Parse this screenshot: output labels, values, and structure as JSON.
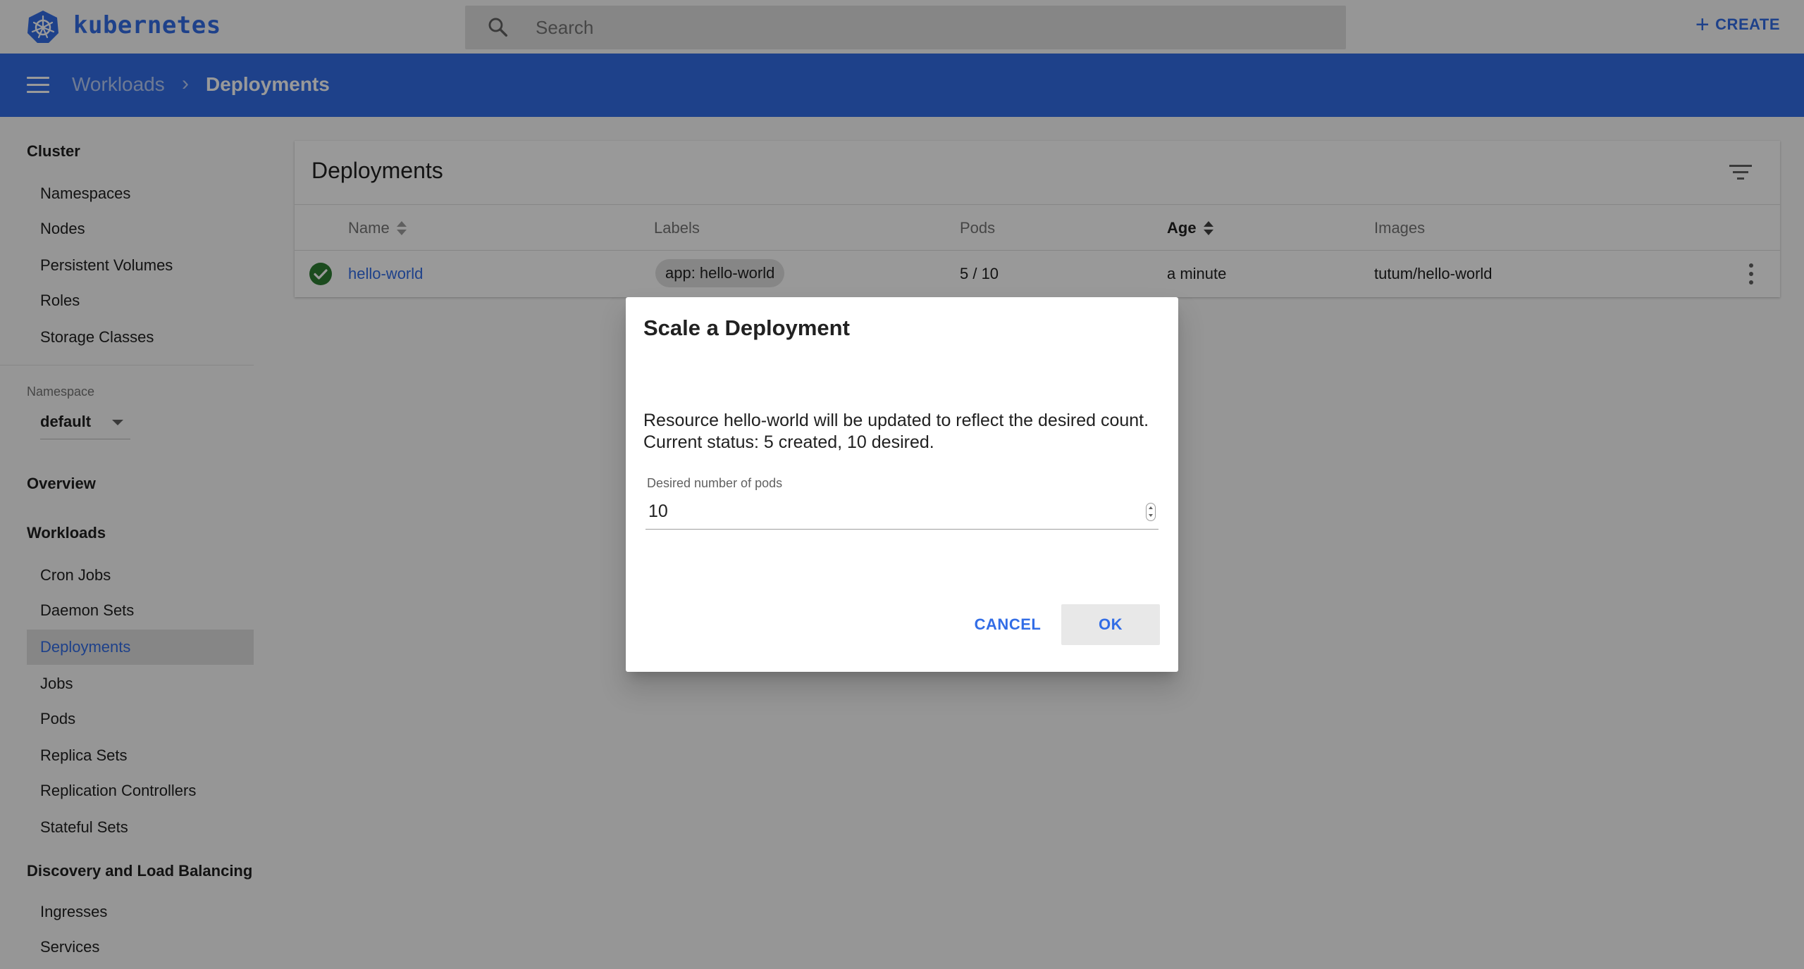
{
  "topbar": {
    "brand": "kubernetes",
    "search_placeholder": "Search",
    "create_label": "CREATE"
  },
  "breadcrumb": {
    "parent": "Workloads",
    "separator": "›",
    "current": "Deployments"
  },
  "sidebar": {
    "cluster_heading": "Cluster",
    "cluster_items": [
      "Namespaces",
      "Nodes",
      "Persistent Volumes",
      "Roles",
      "Storage Classes"
    ],
    "namespace_label": "Namespace",
    "namespace_value": "default",
    "overview": "Overview",
    "workloads_heading": "Workloads",
    "workload_items": [
      "Cron Jobs",
      "Daemon Sets",
      "Deployments",
      "Jobs",
      "Pods",
      "Replica Sets",
      "Replication Controllers",
      "Stateful Sets"
    ],
    "active_item": "Deployments",
    "discovery_heading": "Discovery and Load Balancing",
    "discovery_items": [
      "Ingresses",
      "Services"
    ]
  },
  "card": {
    "title": "Deployments",
    "columns": [
      "Name",
      "Labels",
      "Pods",
      "Age",
      "Images"
    ],
    "rows": [
      {
        "name": "hello-world",
        "label": "app: hello-world",
        "pods": "5 / 10",
        "age": "a minute",
        "images": "tutum/hello-world",
        "status": "ok"
      }
    ]
  },
  "dialog": {
    "title": "Scale a Deployment",
    "line1": "Resource hello-world will be updated to reflect the desired count.",
    "line2": "Current status: 5 created, 10 desired.",
    "field_label": "Desired number of pods",
    "field_value": "10",
    "cancel_label": "CANCEL",
    "ok_label": "OK"
  },
  "colors": {
    "brand": "#326de6",
    "success": "#2e7d32",
    "overlay": "rgba(0,0,0,0.4)"
  },
  "icons": [
    "kubernetes-logo-icon",
    "search-icon",
    "plus-icon",
    "menu-icon",
    "chevron-right-icon",
    "filter-icon",
    "sort-icon",
    "check-circle-icon",
    "more-vert-icon",
    "dropdown-caret-icon"
  ]
}
